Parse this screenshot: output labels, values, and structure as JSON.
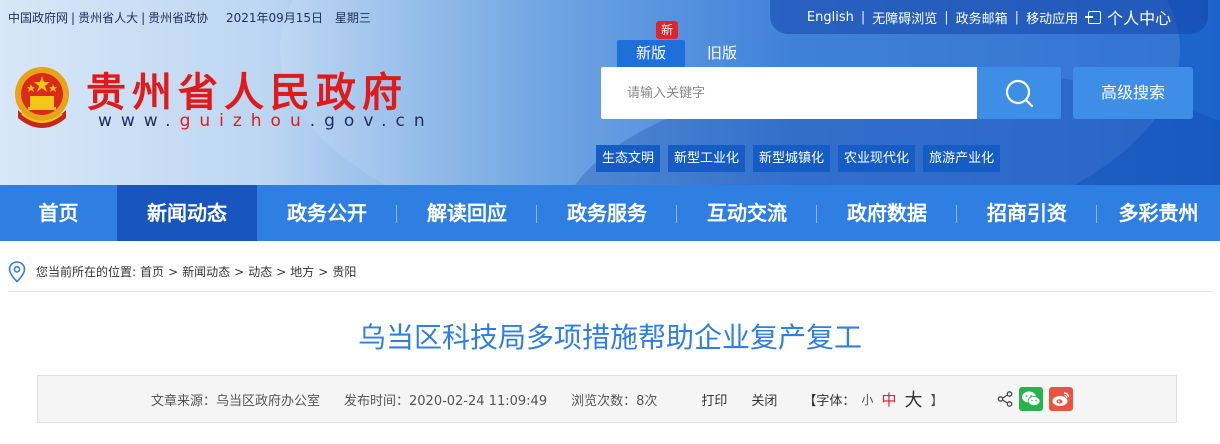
{
  "top_links": {
    "gov_portal": "中国政府网",
    "npc": "贵州省人大",
    "cppcc": "贵州省政协",
    "date": "2021年09月15日",
    "weekday": "星期三",
    "separator": "|"
  },
  "utility_links": {
    "english": "English",
    "accessible": "无障碍浏览",
    "mail": "政务邮箱",
    "mobile": "移动应用",
    "personal_center": "个人中心",
    "separator": "|"
  },
  "logo": {
    "title": "贵州省人民政府",
    "domain_prefix": "www.",
    "domain_name": "guizhou",
    "domain_suffix": ".gov.cn"
  },
  "version": {
    "badge": "新",
    "new_label": "新版",
    "old_label": "旧版"
  },
  "search": {
    "placeholder": "请输入关键字",
    "advanced_label": "高级搜索"
  },
  "topic_tags": [
    "生态文明",
    "新型工业化",
    "新型城镇化",
    "农业现代化",
    "旅游产业化"
  ],
  "nav": {
    "items": [
      "首页",
      "新闻动态",
      "政务公开",
      "解读回应",
      "政务服务",
      "互动交流",
      "政府数据",
      "招商引资",
      "多彩贵州"
    ],
    "active_index": 1
  },
  "breadcrumb": {
    "prefix": "您当前所在的位置:",
    "items": [
      "首页",
      "新闻动态",
      "动态",
      "地方",
      "贵阳"
    ],
    "separator": ">"
  },
  "article": {
    "title": "乌当区科技局多项措施帮助企业复产复工"
  },
  "meta": {
    "source": "文章来源：乌当区政府办公室",
    "published": "发布时间：2020-02-24 11:09:49",
    "views": "浏览次数：8次",
    "print_label": "打印",
    "close_label": "关闭",
    "font_label": "【字体：",
    "font_small": "小",
    "font_medium": "中",
    "font_large": "大",
    "font_end": "】"
  },
  "colors": {
    "nav_bg": "#2f7fe3",
    "nav_active": "#1856bd",
    "title_red": "#e01a1a",
    "article_title": "#2f7fe3",
    "wechat": "#26b34a",
    "weibo": "#e8553e"
  }
}
